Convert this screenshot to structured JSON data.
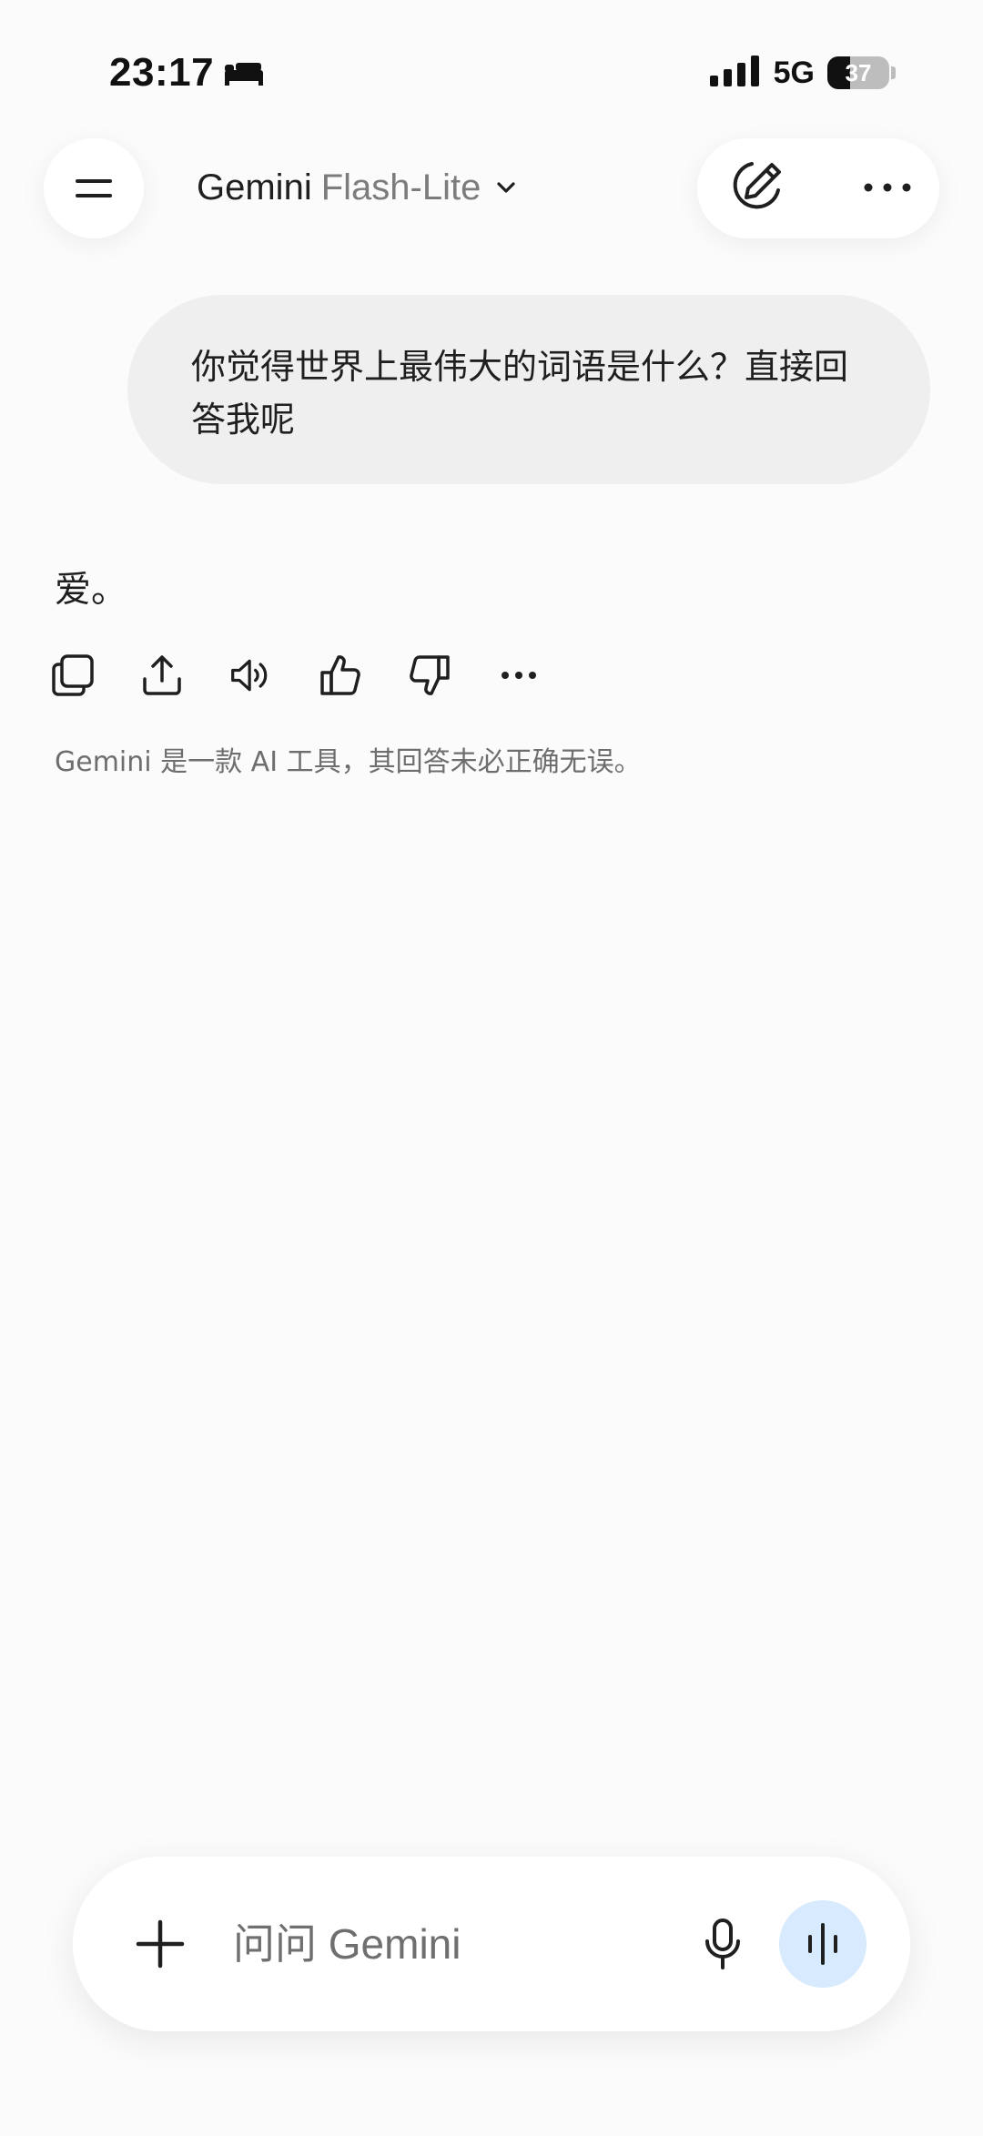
{
  "status_bar": {
    "time": "23:17",
    "sleep_icon": "bed-icon",
    "signal_icon": "cellular-signal-icon",
    "network": "5G",
    "battery_percent": "37",
    "battery_level": 0.37
  },
  "header": {
    "menu_icon": "menu-icon",
    "app_name": "Gemini",
    "model_name": "Flash-Lite",
    "dropdown_icon": "chevron-down-icon",
    "new_chat_icon": "new-chat-icon",
    "more_icon": "more-options-icon"
  },
  "conversation": {
    "user_message": "你觉得世界上最伟大的词语是什么？直接回答我呢",
    "response_text": "爱。",
    "response_actions": [
      "copy-icon",
      "share-icon",
      "read-aloud-icon",
      "thumbs-up-icon",
      "thumbs-down-icon",
      "more-options-icon"
    ],
    "disclaimer": "Gemini 是一款 AI 工具，其回答未必正确无误。"
  },
  "composer": {
    "add_icon": "plus-icon",
    "placeholder": "问问 Gemini",
    "value": "",
    "mic_icon": "microphone-icon",
    "live_icon": "live-voice-icon"
  },
  "colors": {
    "background": "#fbfbfb",
    "bubble": "#efefef",
    "live_button": "#d8eafd",
    "muted_text": "#6e6e6e"
  }
}
